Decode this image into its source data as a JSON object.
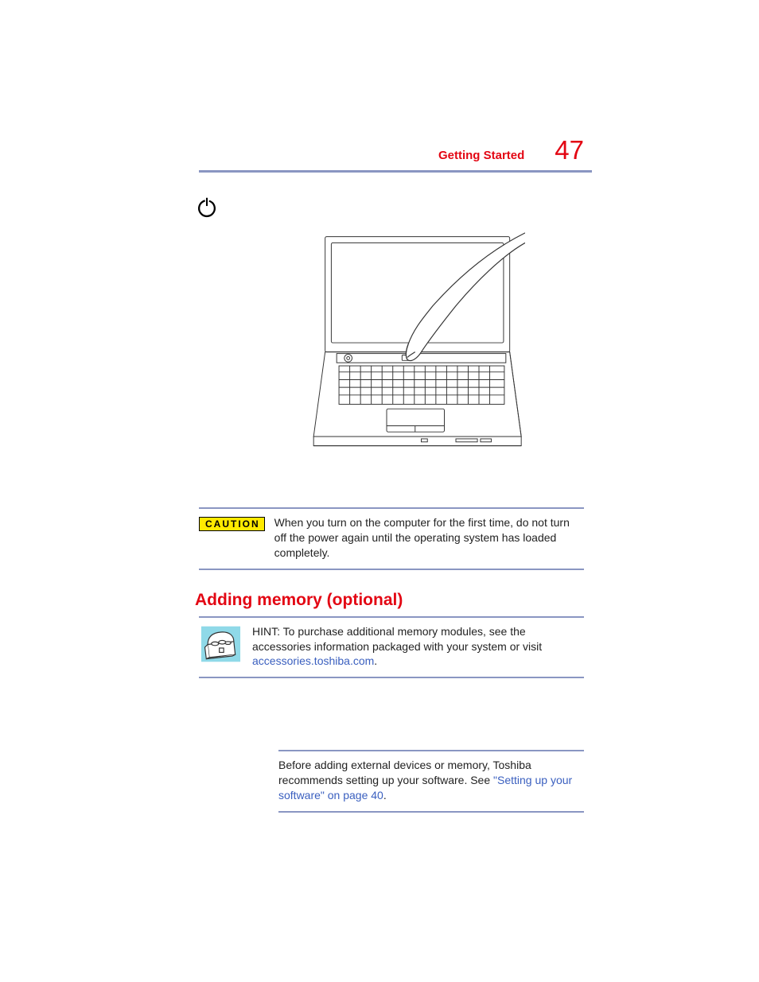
{
  "header": {
    "section_label": "Getting Started",
    "page_number": "47"
  },
  "caution": {
    "badge": "CAUTION",
    "text": "When you turn on the computer for the first time, do not turn off the power again until the operating system has loaded completely."
  },
  "heading": "Adding memory (optional)",
  "hint": {
    "prefix": "HINT: To purchase additional memory modules, see the accessories information packaged with your system or visit ",
    "link": "accessories.toshiba.com",
    "suffix": "."
  },
  "note": {
    "prefix": "Before adding external devices or memory, Toshiba recommends setting up your software. See ",
    "link": "\"Setting up your software\" on page 40",
    "suffix": "."
  }
}
